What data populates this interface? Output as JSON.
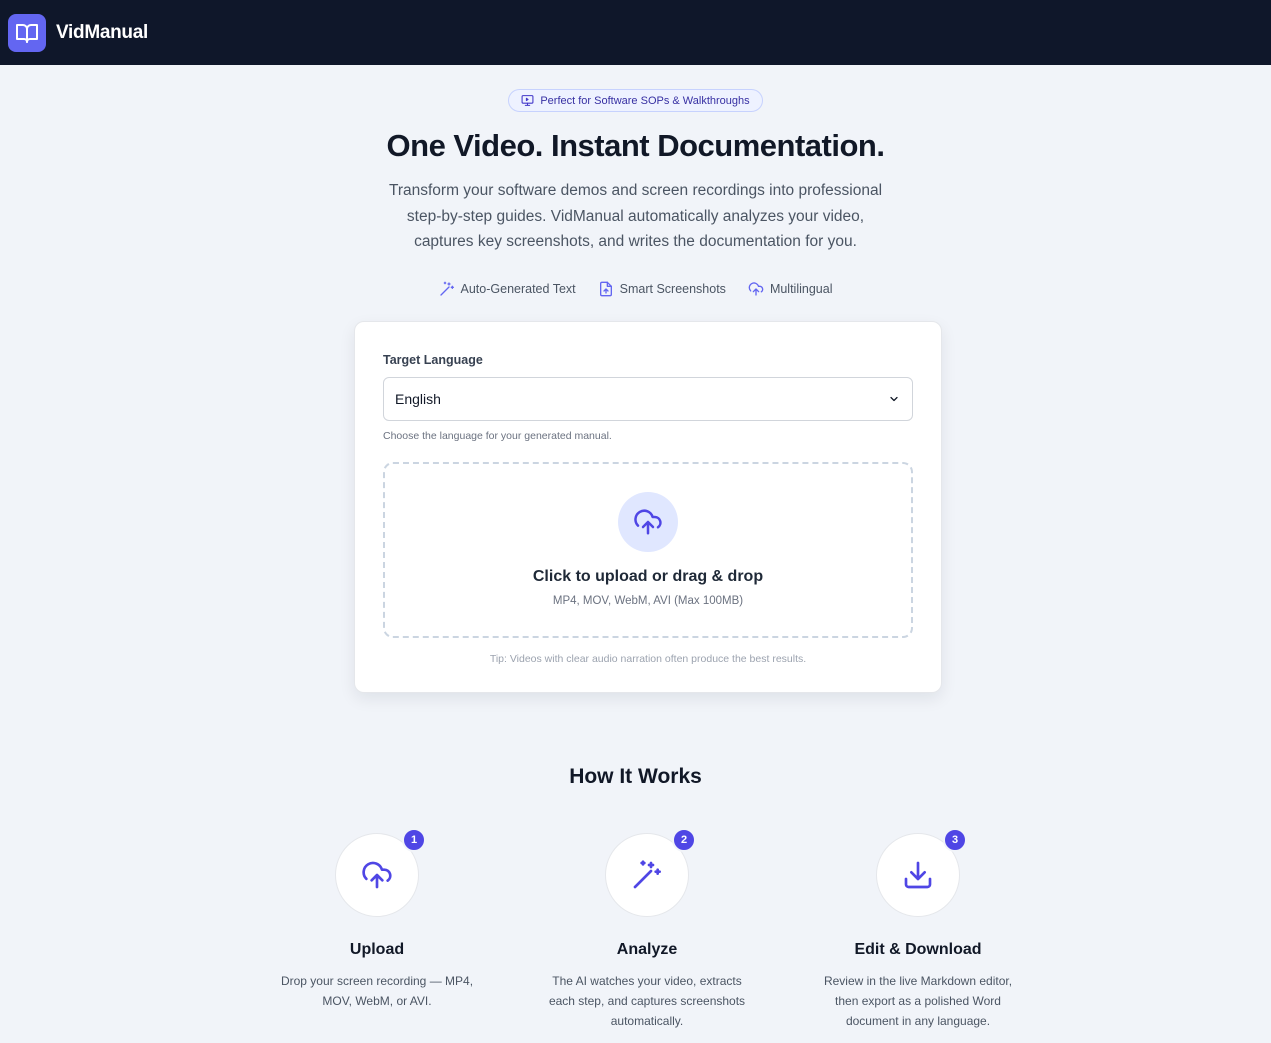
{
  "app": {
    "name": "VidManual",
    "logo_icon": "book-open-icon"
  },
  "hero": {
    "badge": "Perfect for Software SOPs & Walkthroughs",
    "title": "One Video. Instant Documentation.",
    "subtitle": "Transform your software demos and screen recordings into professional step-by-step guides. VidManual automatically analyzes your video, captures key screenshots, and writes the documentation for you.",
    "features": [
      {
        "label": "Auto-Generated Text",
        "icon": "magic-wand-icon"
      },
      {
        "label": "Smart Screenshots",
        "icon": "file-upload-icon"
      },
      {
        "label": "Multilingual",
        "icon": "cloud-upload-icon"
      }
    ]
  },
  "form": {
    "language_label": "Target Language",
    "language_value": "English",
    "language_help": "Choose the language for your generated manual.",
    "upload_title": "Click to upload or drag & drop",
    "upload_formats": "MP4, MOV, WebM, AVI (Max 100MB)",
    "tip": "Tip: Videos with clear audio narration often produce the best results."
  },
  "how": {
    "title": "How It Works",
    "steps": [
      {
        "num": "1",
        "title": "Upload",
        "desc": "Drop your screen recording — MP4, MOV, WebM, or AVI.",
        "icon": "cloud-upload-icon"
      },
      {
        "num": "2",
        "title": "Analyze",
        "desc": "The AI watches your video, extracts each step, and captures screenshots automatically.",
        "icon": "magic-wand-icon"
      },
      {
        "num": "3",
        "title": "Edit & Download",
        "desc": "Review in the live Markdown editor, then export as a polished Word document in any language.",
        "icon": "download-icon"
      }
    ]
  },
  "colors": {
    "accent": "#4f46e5",
    "header_bg": "#0f172a",
    "page_bg": "#f1f4f9"
  }
}
